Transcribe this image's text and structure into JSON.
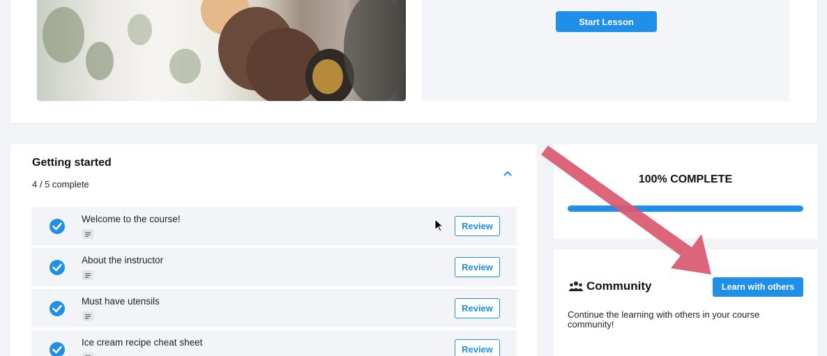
{
  "hero": {
    "start_lesson_label": "Start Lesson"
  },
  "module": {
    "title": "Getting started",
    "progress_text": "4 / 5 complete",
    "collapse_icon": "chevron-up-icon",
    "lessons": [
      {
        "title": "Welcome to the course!",
        "action": "Review",
        "status": "completed",
        "type_icon": "text-lesson-icon"
      },
      {
        "title": "About the instructor",
        "action": "Review",
        "status": "completed",
        "type_icon": "text-lesson-icon"
      },
      {
        "title": "Must have utensils",
        "action": "Review",
        "status": "completed",
        "type_icon": "text-lesson-icon"
      },
      {
        "title": "Ice cream recipe cheat sheet",
        "action": "Review",
        "status": "completed",
        "type_icon": "text-lesson-icon"
      }
    ]
  },
  "progress": {
    "label": "100% COMPLETE",
    "percent": 100
  },
  "community": {
    "icon": "users-icon",
    "title": "Community",
    "button_label": "Learn with others",
    "description": "Continue the learning with others in your course community!"
  },
  "colors": {
    "accent": "#1f8fe8",
    "annotation_arrow": "#d9596f",
    "card": "#ffffff",
    "page_bg": "#f2f3f6"
  }
}
